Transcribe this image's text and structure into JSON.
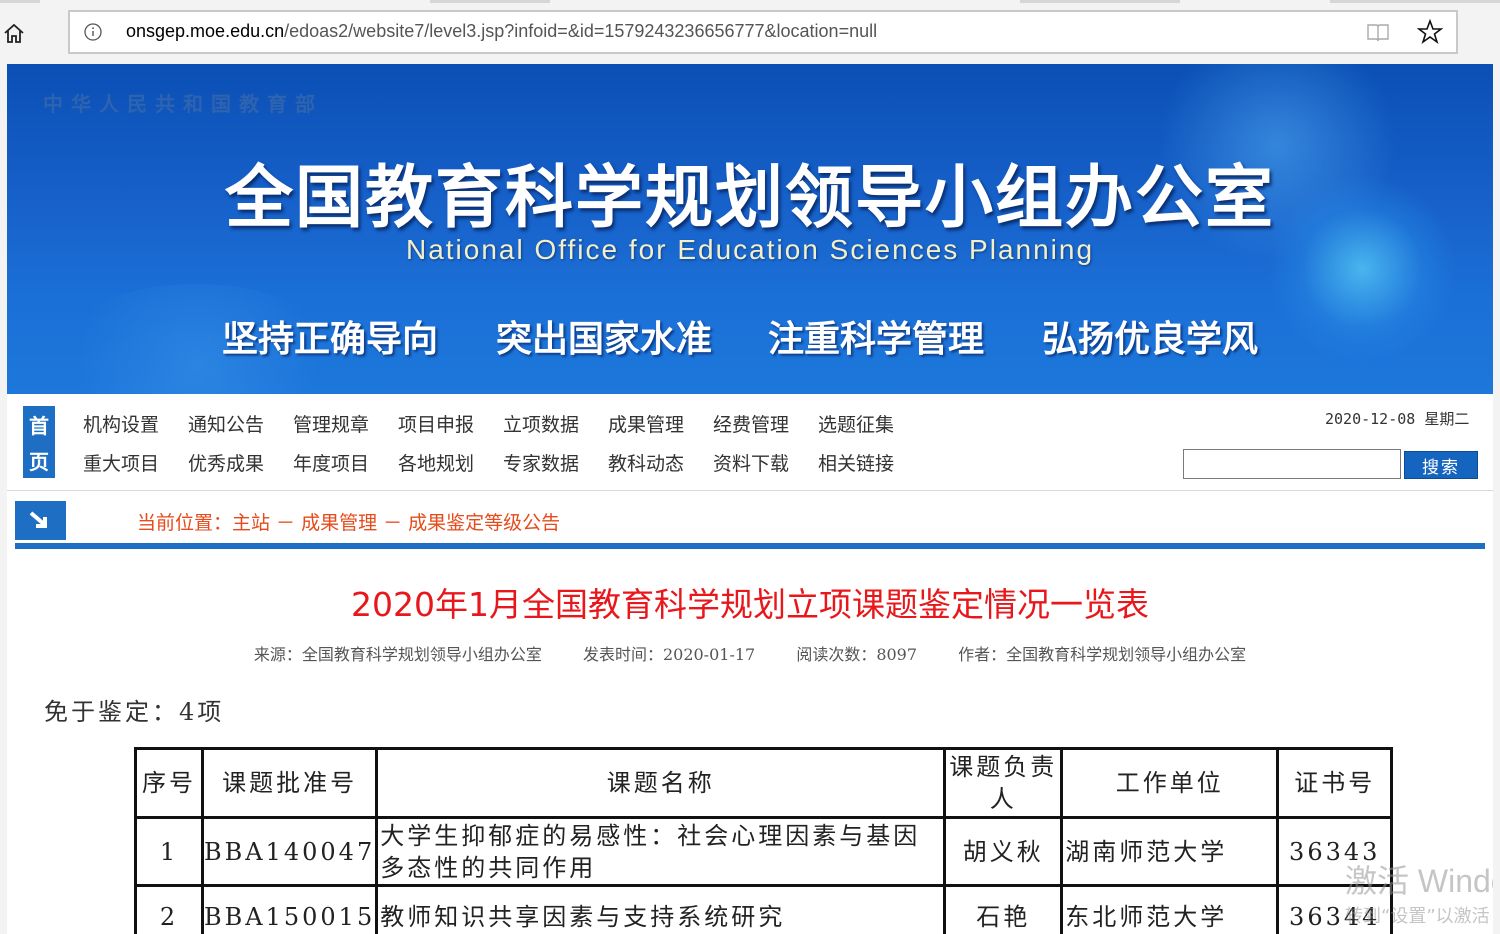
{
  "browser": {
    "url_host": "onsgep.moe.edu.cn",
    "url_path": "/edoas2/website7/level3.jsp?infoid=&id=1579243236656777&location=null"
  },
  "banner": {
    "ministry": "中华人民共和国教育部",
    "office": "全国教育科学规划领导小组办公室",
    "office_en": "National Office for Education Sciences Planning",
    "slogans": [
      "坚持正确导向",
      "突出国家水准",
      "注重科学管理",
      "弘扬优良学风"
    ]
  },
  "nav": {
    "home_top": "首",
    "home_bottom": "页",
    "row1": [
      "机构设置",
      "通知公告",
      "管理规章",
      "项目申报",
      "立项数据",
      "成果管理",
      "经费管理",
      "选题征集"
    ],
    "row2": [
      "重大项目",
      "优秀成果",
      "年度项目",
      "各地规划",
      "专家数据",
      "教科动态",
      "资料下载",
      "相关链接"
    ],
    "date": "2020-12-08 星期二",
    "search_button": "搜索",
    "search_value": ""
  },
  "breadcrumb": "当前位置：主站 － 成果管理 － 成果鉴定等级公告",
  "article": {
    "title": "2020年1月全国教育科学规划立项课题鉴定情况一览表",
    "source": "来源：全国教育科学规划领导小组办公室",
    "published": "发表时间：2020-01-17",
    "reads": "阅读次数：8097",
    "author": "作者：全国教育科学规划领导小组办公室",
    "exempt": "免于鉴定：4项"
  },
  "table": {
    "headers": [
      "序号",
      "课题批准号",
      "课题名称",
      "课题负责人",
      "工作单位",
      "证书号"
    ],
    "rows": [
      [
        "1",
        "BBA140047",
        "大学生抑郁症的易感性：社会心理因素与基因多态性的共同作用",
        "胡义秋",
        "湖南师范大学",
        "36343"
      ],
      [
        "2",
        "BBA150015",
        "教师知识共享因素与支持系统研究",
        "石艳",
        "东北师范大学",
        "36344"
      ]
    ]
  },
  "watermark": {
    "line1": "激活 Windows",
    "line2": "转到“设置”以激活 Windows。"
  }
}
